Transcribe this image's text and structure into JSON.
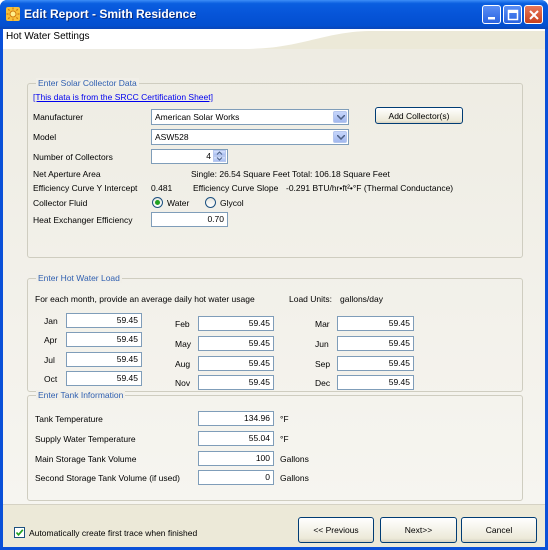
{
  "window": {
    "title": "Edit Report - Smith Residence"
  },
  "header": {
    "title": "Hot Water Settings"
  },
  "solar_collector": {
    "legend": "Enter Solar Collector Data",
    "srcc_link": "[This data is from the SRCC Certification Sheet]",
    "manufacturer_label": "Manufacturer",
    "manufacturer_value": "American Solar Works",
    "add_collector_label": "Add Collector(s)",
    "model_label": "Model",
    "model_value": "ASW528",
    "num_collectors_label": "Number of Collectors",
    "num_collectors_value": "4",
    "net_aperture_label": "Net Aperture Area",
    "single_area": "Single: 26.54 Square Feet",
    "total_area": "Total: 106.18 Square Feet",
    "eff_intercept_label": "Efficiency Curve Y Intercept",
    "eff_intercept_value": "0.481",
    "eff_slope_label": "Efficiency Curve Slope",
    "eff_slope_value": "-0.291 BTU/hr•ft²•°F (Thermal Conductance)",
    "collector_fluid_label": "Collector Fluid",
    "fluid_water_label": "Water",
    "fluid_glycol_label": "Glycol",
    "fluid_selected": "Water",
    "hx_efficiency_label": "Heat Exchanger Efficiency",
    "hx_efficiency_value": "0.70"
  },
  "hot_water_load": {
    "legend": "Enter Hot Water Load",
    "instruction": "For each month, provide an average daily hot water usage",
    "units_label": "Load Units:",
    "units_value": "gallons/day",
    "months": [
      {
        "label": "Jan",
        "value": "59.45"
      },
      {
        "label": "Apr",
        "value": "59.45"
      },
      {
        "label": "Jul",
        "value": "59.45"
      },
      {
        "label": "Oct",
        "value": "59.45"
      },
      {
        "label": "Feb",
        "value": "59.45"
      },
      {
        "label": "May",
        "value": "59.45"
      },
      {
        "label": "Aug",
        "value": "59.45"
      },
      {
        "label": "Nov",
        "value": "59.45"
      },
      {
        "label": "Mar",
        "value": "59.45"
      },
      {
        "label": "Jun",
        "value": "59.45"
      },
      {
        "label": "Sep",
        "value": "59.45"
      },
      {
        "label": "Dec",
        "value": "59.45"
      }
    ]
  },
  "tank": {
    "legend": "Enter Tank Information",
    "tank_temp_label": "Tank Temperature",
    "tank_temp_value": "134.96",
    "tank_temp_unit": "°F",
    "supply_temp_label": "Supply Water Temperature",
    "supply_temp_value": "55.04",
    "supply_temp_unit": "°F",
    "main_volume_label": "Main Storage Tank Volume",
    "main_volume_value": "100",
    "main_volume_unit": "Gallons",
    "second_volume_label": "Second Storage Tank Volume (if used)",
    "second_volume_value": "0",
    "second_volume_unit": "Gallons"
  },
  "footer": {
    "auto_trace_label": "Automatically create first trace when finished",
    "auto_trace_checked": true,
    "previous_label": "<< Previous",
    "next_label": "Next>>",
    "cancel_label": "Cancel"
  }
}
